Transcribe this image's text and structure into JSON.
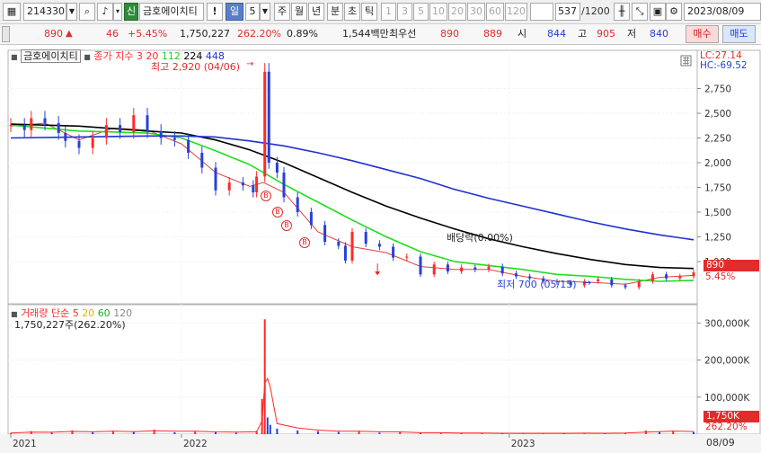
{
  "toolbar": {
    "code": "214330",
    "shin_label": "신",
    "stock_name": "금호에이치티",
    "alert_label": "!",
    "period_active": "일",
    "period_number": "5",
    "periods": [
      "주",
      "월",
      "년",
      "분",
      "초",
      "틱"
    ],
    "minute_options": [
      "1",
      "3",
      "5",
      "10",
      "20",
      "30",
      "60",
      "120"
    ],
    "count": "537",
    "count_total": "/1200",
    "date": "2023/08/09",
    "colors": {
      "toolbar_bg": "#f0f0f0",
      "active_tab": "#5b7ec9"
    },
    "icons": [
      "chart-type-icon",
      "dropdown-arrow-icon",
      "search-icon",
      "speaker-icon",
      "candle-toggle-icon",
      "chart-settings-icon",
      "save-icon",
      "gear-icon"
    ]
  },
  "quote": {
    "price": "890",
    "change": "46",
    "change_pct": "+5.45%",
    "volume": "1,750,227",
    "volume_ratio": "262.20%",
    "turnover": "0.89%",
    "amount": "1,544백만",
    "priority_label": "최우선",
    "ask": "890",
    "bid": "889",
    "open_label": "시",
    "open": "844",
    "high_label": "고",
    "high": "905",
    "low_label": "저",
    "low": "840",
    "buy_label": "매수",
    "sell_label": "매도",
    "colors": {
      "up": "#e32b2b",
      "down": "#2740d8"
    }
  },
  "price_panel": {
    "name_tag": "금호에이치티",
    "indicator_label": "종가 지수",
    "ma_periods": [
      "3",
      "20",
      "112",
      "224",
      "448"
    ],
    "ma_colors": [
      "#ff2a2a",
      "#ff2a2a",
      "#22cc22",
      "#000000",
      "#1f2fd6"
    ],
    "lc": "LC:27.14",
    "hc": "HC:-69.52",
    "max_label": "최고 2,920 (04/06)",
    "min_label": "최저 700 (05/15)",
    "dividend_label": "배당락(0.00%)",
    "price_tag": "890",
    "pct_tag": "5.45%",
    "buy_markers": [
      "B",
      "B",
      "B",
      "B"
    ],
    "colors": {
      "up_candle": "#ff2a2a",
      "down_candle": "#2740d8"
    }
  },
  "volume_panel": {
    "label_name": "거래량",
    "label_type": "단순",
    "ma_periods": [
      "5",
      "20",
      "60",
      "120"
    ],
    "ma_colors": [
      "#ff2a2a",
      "#e0b400",
      "#22aa22",
      "#888888"
    ],
    "value": "1,750,227주(262.20%)",
    "tag": "1,750K",
    "tag_pct": "262.20%"
  },
  "x_axis": {
    "ticks": [
      "2021",
      "2022",
      "2023"
    ],
    "right_label": "08/09"
  },
  "chart_data": {
    "type": "line",
    "price_axis": {
      "ylim": [
        700,
        2900
      ],
      "ticks": [
        2750,
        2500,
        2250,
        2000,
        1750,
        1500,
        1250,
        1000
      ]
    },
    "price_axis_labels": [
      "2,750",
      "2,500",
      "2,250",
      "2,000",
      "1,750",
      "1,500",
      "1,250",
      "1,000"
    ],
    "volume_axis": {
      "ylim": [
        0,
        330
      ],
      "ticks": [
        300,
        200,
        100
      ],
      "unit": "K"
    },
    "volume_axis_labels": [
      "300,000K",
      "200,000K",
      "100,000K"
    ],
    "x_ticks": [
      {
        "label": "2021",
        "t": 0.0
      },
      {
        "label": "2022",
        "t": 0.25
      },
      {
        "label": "2023",
        "t": 0.73
      }
    ],
    "close": [
      [
        0.0,
        2380
      ],
      [
        0.02,
        2330
      ],
      [
        0.03,
        2450
      ],
      [
        0.05,
        2400
      ],
      [
        0.07,
        2300
      ],
      [
        0.08,
        2220
      ],
      [
        0.1,
        2150
      ],
      [
        0.12,
        2250
      ],
      [
        0.14,
        2380
      ],
      [
        0.16,
        2310
      ],
      [
        0.18,
        2480
      ],
      [
        0.2,
        2320
      ],
      [
        0.22,
        2250
      ],
      [
        0.24,
        2230
      ],
      [
        0.26,
        2100
      ],
      [
        0.28,
        1950
      ],
      [
        0.3,
        1720
      ],
      [
        0.32,
        1800
      ],
      [
        0.34,
        1770
      ],
      [
        0.355,
        1700
      ],
      [
        0.36,
        1860
      ],
      [
        0.372,
        2920
      ],
      [
        0.378,
        2000
      ],
      [
        0.39,
        1900
      ],
      [
        0.4,
        1650
      ],
      [
        0.42,
        1500
      ],
      [
        0.44,
        1370
      ],
      [
        0.46,
        1200
      ],
      [
        0.48,
        1160
      ],
      [
        0.49,
        1010
      ],
      [
        0.5,
        1300
      ],
      [
        0.52,
        1180
      ],
      [
        0.54,
        1150
      ],
      [
        0.56,
        1040
      ],
      [
        0.58,
        1050
      ],
      [
        0.6,
        870
      ],
      [
        0.62,
        970
      ],
      [
        0.64,
        900
      ],
      [
        0.66,
        940
      ],
      [
        0.68,
        920
      ],
      [
        0.7,
        950
      ],
      [
        0.72,
        880
      ],
      [
        0.74,
        850
      ],
      [
        0.76,
        830
      ],
      [
        0.78,
        800
      ],
      [
        0.8,
        790
      ],
      [
        0.82,
        760
      ],
      [
        0.84,
        800
      ],
      [
        0.86,
        820
      ],
      [
        0.88,
        760
      ],
      [
        0.9,
        740
      ],
      [
        0.92,
        800
      ],
      [
        0.94,
        870
      ],
      [
        0.96,
        830
      ],
      [
        0.98,
        850
      ],
      [
        1.0,
        890
      ]
    ],
    "series": [
      {
        "name": "20",
        "color": "#e04040",
        "points": [
          [
            0.0,
            2370
          ],
          [
            0.05,
            2400
          ],
          [
            0.1,
            2230
          ],
          [
            0.15,
            2350
          ],
          [
            0.2,
            2330
          ],
          [
            0.25,
            2190
          ],
          [
            0.3,
            1900
          ],
          [
            0.35,
            1760
          ],
          [
            0.37,
            1800
          ],
          [
            0.4,
            1700
          ],
          [
            0.45,
            1300
          ],
          [
            0.5,
            1150
          ],
          [
            0.55,
            1090
          ],
          [
            0.6,
            950
          ],
          [
            0.65,
            920
          ],
          [
            0.7,
            920
          ],
          [
            0.75,
            850
          ],
          [
            0.8,
            800
          ],
          [
            0.85,
            790
          ],
          [
            0.9,
            770
          ],
          [
            0.95,
            840
          ],
          [
            1.0,
            860
          ]
        ]
      },
      {
        "name": "112",
        "color": "#22dd22",
        "points": [
          [
            0.0,
            2380
          ],
          [
            0.1,
            2320
          ],
          [
            0.2,
            2300
          ],
          [
            0.25,
            2250
          ],
          [
            0.3,
            2120
          ],
          [
            0.35,
            1980
          ],
          [
            0.4,
            1780
          ],
          [
            0.45,
            1600
          ],
          [
            0.5,
            1420
          ],
          [
            0.55,
            1250
          ],
          [
            0.6,
            1100
          ],
          [
            0.65,
            1000
          ],
          [
            0.7,
            960
          ],
          [
            0.75,
            920
          ],
          [
            0.8,
            870
          ],
          [
            0.85,
            850
          ],
          [
            0.9,
            820
          ],
          [
            0.95,
            800
          ],
          [
            1.0,
            810
          ]
        ]
      },
      {
        "name": "224",
        "color": "#000000",
        "points": [
          [
            0.0,
            2390
          ],
          [
            0.1,
            2370
          ],
          [
            0.2,
            2320
          ],
          [
            0.25,
            2300
          ],
          [
            0.3,
            2230
          ],
          [
            0.35,
            2130
          ],
          [
            0.4,
            2000
          ],
          [
            0.45,
            1850
          ],
          [
            0.5,
            1700
          ],
          [
            0.55,
            1560
          ],
          [
            0.6,
            1440
          ],
          [
            0.65,
            1330
          ],
          [
            0.7,
            1230
          ],
          [
            0.75,
            1150
          ],
          [
            0.8,
            1080
          ],
          [
            0.85,
            1020
          ],
          [
            0.9,
            970
          ],
          [
            0.95,
            940
          ],
          [
            1.0,
            930
          ]
        ]
      },
      {
        "name": "448",
        "color": "#1f2fd6",
        "points": [
          [
            0.0,
            2250
          ],
          [
            0.1,
            2260
          ],
          [
            0.2,
            2270
          ],
          [
            0.25,
            2270
          ],
          [
            0.3,
            2260
          ],
          [
            0.35,
            2220
          ],
          [
            0.4,
            2170
          ],
          [
            0.45,
            2100
          ],
          [
            0.5,
            2020
          ],
          [
            0.55,
            1930
          ],
          [
            0.6,
            1840
          ],
          [
            0.65,
            1730
          ],
          [
            0.7,
            1640
          ],
          [
            0.75,
            1560
          ],
          [
            0.8,
            1480
          ],
          [
            0.85,
            1400
          ],
          [
            0.9,
            1330
          ],
          [
            0.95,
            1270
          ],
          [
            1.0,
            1220
          ]
        ]
      }
    ],
    "volume": [
      [
        0.0,
        3
      ],
      [
        0.03,
        8
      ],
      [
        0.06,
        4
      ],
      [
        0.09,
        10
      ],
      [
        0.12,
        5
      ],
      [
        0.15,
        9
      ],
      [
        0.18,
        6
      ],
      [
        0.21,
        12
      ],
      [
        0.24,
        5
      ],
      [
        0.27,
        7
      ],
      [
        0.3,
        6
      ],
      [
        0.33,
        4
      ],
      [
        0.36,
        9
      ],
      [
        0.368,
        95
      ],
      [
        0.372,
        310
      ],
      [
        0.376,
        45
      ],
      [
        0.38,
        25
      ],
      [
        0.39,
        15
      ],
      [
        0.42,
        10
      ],
      [
        0.45,
        8
      ],
      [
        0.48,
        6
      ],
      [
        0.51,
        9
      ],
      [
        0.54,
        4
      ],
      [
        0.57,
        5
      ],
      [
        0.6,
        3
      ],
      [
        0.63,
        4
      ],
      [
        0.66,
        2
      ],
      [
        0.69,
        3
      ],
      [
        0.72,
        2
      ],
      [
        0.75,
        2
      ],
      [
        0.78,
        3
      ],
      [
        0.81,
        2
      ],
      [
        0.84,
        3
      ],
      [
        0.87,
        2
      ],
      [
        0.9,
        4
      ],
      [
        0.93,
        10
      ],
      [
        0.95,
        6
      ],
      [
        0.97,
        9
      ],
      [
        1.0,
        6
      ]
    ]
  }
}
